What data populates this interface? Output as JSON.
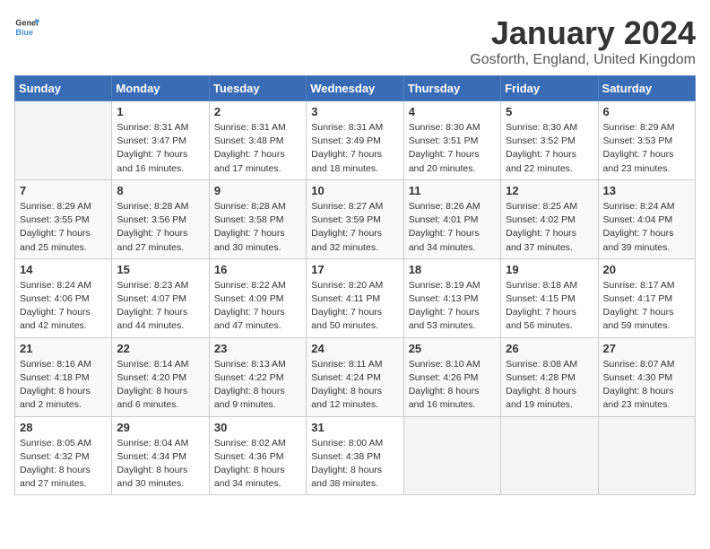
{
  "header": {
    "logo_general": "General",
    "logo_blue": "Blue",
    "month": "January 2024",
    "location": "Gosforth, England, United Kingdom"
  },
  "weekdays": [
    "Sunday",
    "Monday",
    "Tuesday",
    "Wednesday",
    "Thursday",
    "Friday",
    "Saturday"
  ],
  "weeks": [
    [
      {
        "day": "",
        "empty": true
      },
      {
        "day": "1",
        "sunrise": "Sunrise: 8:31 AM",
        "sunset": "Sunset: 3:47 PM",
        "daylight": "Daylight: 7 hours and 16 minutes."
      },
      {
        "day": "2",
        "sunrise": "Sunrise: 8:31 AM",
        "sunset": "Sunset: 3:48 PM",
        "daylight": "Daylight: 7 hours and 17 minutes."
      },
      {
        "day": "3",
        "sunrise": "Sunrise: 8:31 AM",
        "sunset": "Sunset: 3:49 PM",
        "daylight": "Daylight: 7 hours and 18 minutes."
      },
      {
        "day": "4",
        "sunrise": "Sunrise: 8:30 AM",
        "sunset": "Sunset: 3:51 PM",
        "daylight": "Daylight: 7 hours and 20 minutes."
      },
      {
        "day": "5",
        "sunrise": "Sunrise: 8:30 AM",
        "sunset": "Sunset: 3:52 PM",
        "daylight": "Daylight: 7 hours and 22 minutes."
      },
      {
        "day": "6",
        "sunrise": "Sunrise: 8:29 AM",
        "sunset": "Sunset: 3:53 PM",
        "daylight": "Daylight: 7 hours and 23 minutes."
      }
    ],
    [
      {
        "day": "7",
        "sunrise": "Sunrise: 8:29 AM",
        "sunset": "Sunset: 3:55 PM",
        "daylight": "Daylight: 7 hours and 25 minutes."
      },
      {
        "day": "8",
        "sunrise": "Sunrise: 8:28 AM",
        "sunset": "Sunset: 3:56 PM",
        "daylight": "Daylight: 7 hours and 27 minutes."
      },
      {
        "day": "9",
        "sunrise": "Sunrise: 8:28 AM",
        "sunset": "Sunset: 3:58 PM",
        "daylight": "Daylight: 7 hours and 30 minutes."
      },
      {
        "day": "10",
        "sunrise": "Sunrise: 8:27 AM",
        "sunset": "Sunset: 3:59 PM",
        "daylight": "Daylight: 7 hours and 32 minutes."
      },
      {
        "day": "11",
        "sunrise": "Sunrise: 8:26 AM",
        "sunset": "Sunset: 4:01 PM",
        "daylight": "Daylight: 7 hours and 34 minutes."
      },
      {
        "day": "12",
        "sunrise": "Sunrise: 8:25 AM",
        "sunset": "Sunset: 4:02 PM",
        "daylight": "Daylight: 7 hours and 37 minutes."
      },
      {
        "day": "13",
        "sunrise": "Sunrise: 8:24 AM",
        "sunset": "Sunset: 4:04 PM",
        "daylight": "Daylight: 7 hours and 39 minutes."
      }
    ],
    [
      {
        "day": "14",
        "sunrise": "Sunrise: 8:24 AM",
        "sunset": "Sunset: 4:06 PM",
        "daylight": "Daylight: 7 hours and 42 minutes."
      },
      {
        "day": "15",
        "sunrise": "Sunrise: 8:23 AM",
        "sunset": "Sunset: 4:07 PM",
        "daylight": "Daylight: 7 hours and 44 minutes."
      },
      {
        "day": "16",
        "sunrise": "Sunrise: 8:22 AM",
        "sunset": "Sunset: 4:09 PM",
        "daylight": "Daylight: 7 hours and 47 minutes."
      },
      {
        "day": "17",
        "sunrise": "Sunrise: 8:20 AM",
        "sunset": "Sunset: 4:11 PM",
        "daylight": "Daylight: 7 hours and 50 minutes."
      },
      {
        "day": "18",
        "sunrise": "Sunrise: 8:19 AM",
        "sunset": "Sunset: 4:13 PM",
        "daylight": "Daylight: 7 hours and 53 minutes."
      },
      {
        "day": "19",
        "sunrise": "Sunrise: 8:18 AM",
        "sunset": "Sunset: 4:15 PM",
        "daylight": "Daylight: 7 hours and 56 minutes."
      },
      {
        "day": "20",
        "sunrise": "Sunrise: 8:17 AM",
        "sunset": "Sunset: 4:17 PM",
        "daylight": "Daylight: 7 hours and 59 minutes."
      }
    ],
    [
      {
        "day": "21",
        "sunrise": "Sunrise: 8:16 AM",
        "sunset": "Sunset: 4:18 PM",
        "daylight": "Daylight: 8 hours and 2 minutes."
      },
      {
        "day": "22",
        "sunrise": "Sunrise: 8:14 AM",
        "sunset": "Sunset: 4:20 PM",
        "daylight": "Daylight: 8 hours and 6 minutes."
      },
      {
        "day": "23",
        "sunrise": "Sunrise: 8:13 AM",
        "sunset": "Sunset: 4:22 PM",
        "daylight": "Daylight: 8 hours and 9 minutes."
      },
      {
        "day": "24",
        "sunrise": "Sunrise: 8:11 AM",
        "sunset": "Sunset: 4:24 PM",
        "daylight": "Daylight: 8 hours and 12 minutes."
      },
      {
        "day": "25",
        "sunrise": "Sunrise: 8:10 AM",
        "sunset": "Sunset: 4:26 PM",
        "daylight": "Daylight: 8 hours and 16 minutes."
      },
      {
        "day": "26",
        "sunrise": "Sunrise: 8:08 AM",
        "sunset": "Sunset: 4:28 PM",
        "daylight": "Daylight: 8 hours and 19 minutes."
      },
      {
        "day": "27",
        "sunrise": "Sunrise: 8:07 AM",
        "sunset": "Sunset: 4:30 PM",
        "daylight": "Daylight: 8 hours and 23 minutes."
      }
    ],
    [
      {
        "day": "28",
        "sunrise": "Sunrise: 8:05 AM",
        "sunset": "Sunset: 4:32 PM",
        "daylight": "Daylight: 8 hours and 27 minutes."
      },
      {
        "day": "29",
        "sunrise": "Sunrise: 8:04 AM",
        "sunset": "Sunset: 4:34 PM",
        "daylight": "Daylight: 8 hours and 30 minutes."
      },
      {
        "day": "30",
        "sunrise": "Sunrise: 8:02 AM",
        "sunset": "Sunset: 4:36 PM",
        "daylight": "Daylight: 8 hours and 34 minutes."
      },
      {
        "day": "31",
        "sunrise": "Sunrise: 8:00 AM",
        "sunset": "Sunset: 4:38 PM",
        "daylight": "Daylight: 8 hours and 38 minutes."
      },
      {
        "day": "",
        "empty": true
      },
      {
        "day": "",
        "empty": true
      },
      {
        "day": "",
        "empty": true
      }
    ]
  ]
}
